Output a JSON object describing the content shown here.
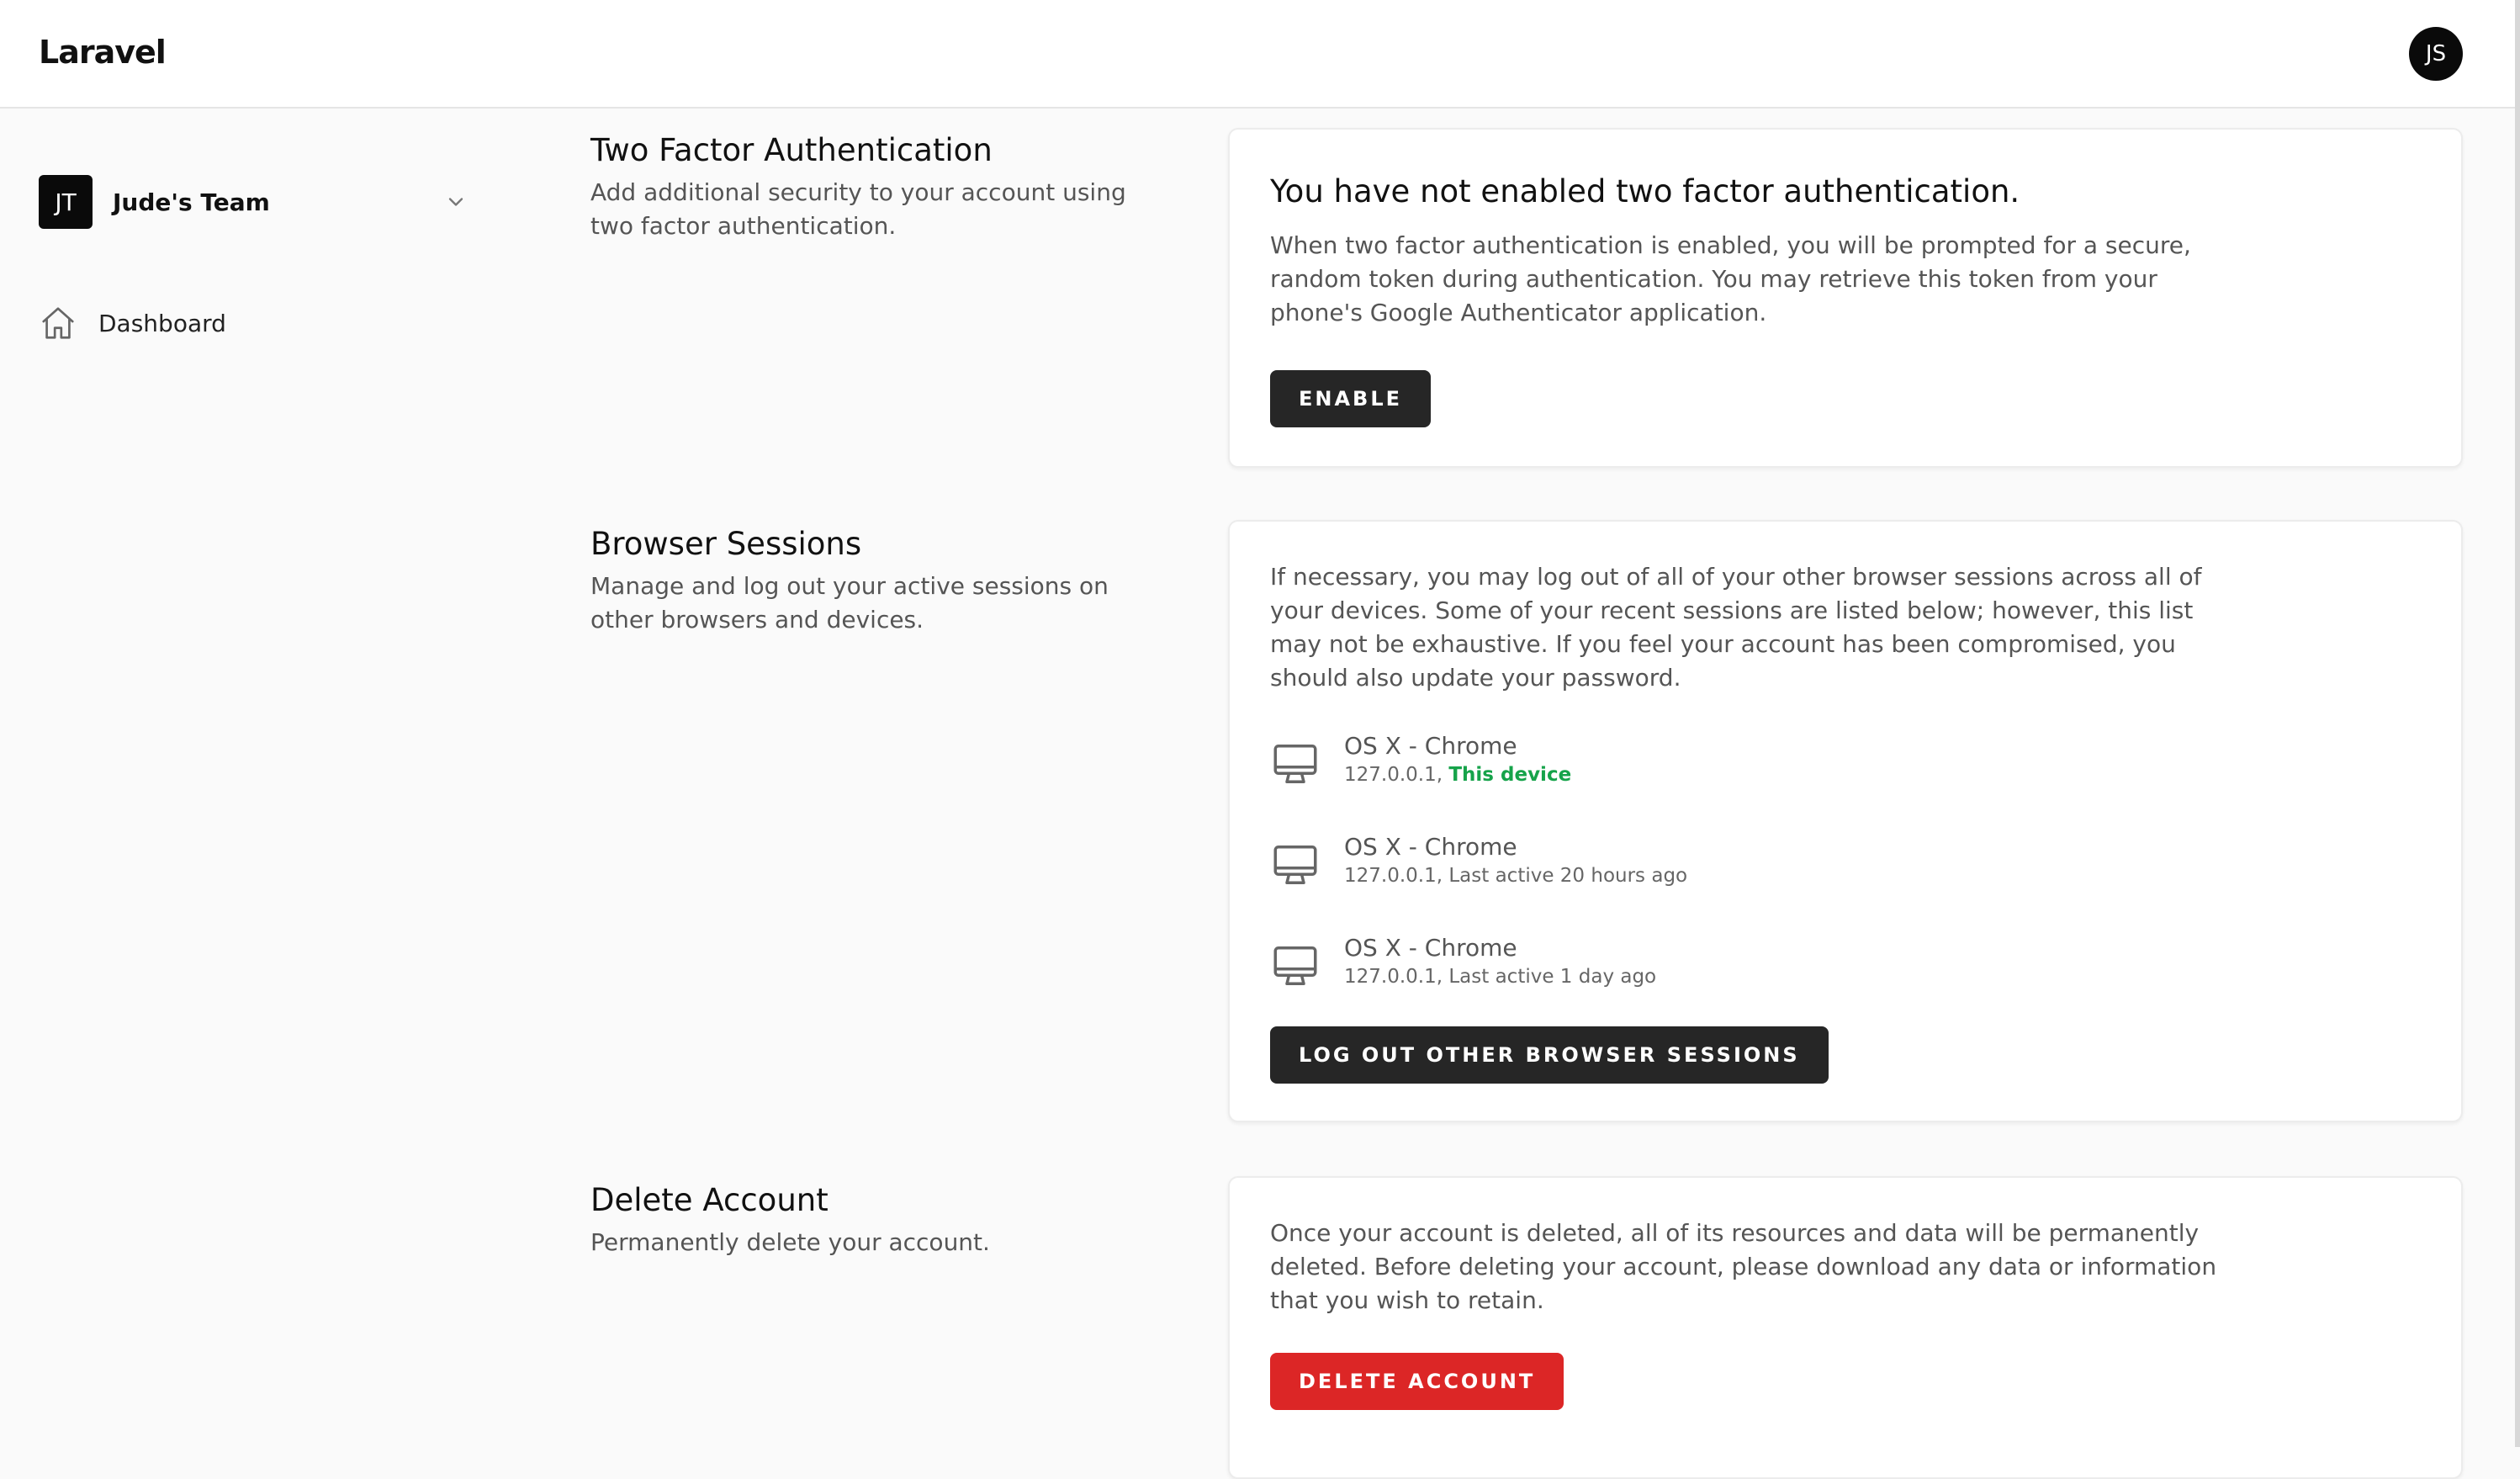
{
  "header": {
    "brand": "Laravel",
    "user_initials": "JS"
  },
  "sidebar": {
    "team": {
      "initials": "JT",
      "name": "Jude's Team"
    },
    "nav": [
      {
        "label": "Dashboard",
        "icon": "home-icon"
      }
    ]
  },
  "two_factor": {
    "title": "Two Factor Authentication",
    "description": "Add additional security to your account using two factor authentication.",
    "card_heading": "You have not enabled two factor authentication.",
    "card_text": "When two factor authentication is enabled, you will be prompted for a secure, random token during authentication. You may retrieve this token from your phone's Google Authenticator application.",
    "button": "ENABLE"
  },
  "browser_sessions": {
    "title": "Browser Sessions",
    "description": "Manage and log out your active sessions on other browsers and devices.",
    "card_text": "If necessary, you may log out of all of your other browser sessions across all of your devices. Some of your recent sessions are listed below; however, this list may not be exhaustive. If you feel your account has been compromised, you should also update your password.",
    "sessions": [
      {
        "name": "OS X - Chrome",
        "ip": "127.0.0.1,",
        "status": "This device",
        "current": true,
        "icon": "monitor-icon"
      },
      {
        "name": "OS X - Chrome",
        "ip": "127.0.0.1,",
        "status": "Last active 20 hours ago",
        "current": false,
        "icon": "monitor-icon"
      },
      {
        "name": "OS X - Chrome",
        "ip": "127.0.0.1,",
        "status": "Last active 1 day ago",
        "current": false,
        "icon": "monitor-icon"
      }
    ],
    "button": "LOG OUT OTHER BROWSER SESSIONS"
  },
  "delete_account": {
    "title": "Delete Account",
    "description": "Permanently delete your account.",
    "card_text": "Once your account is deleted, all of its resources and data will be permanently deleted. Before deleting your account, please download any data or information that you wish to retain.",
    "button": "DELETE ACCOUNT"
  },
  "colors": {
    "accent_dark": "#262626",
    "danger": "#dc2626",
    "success": "#16a34a"
  }
}
